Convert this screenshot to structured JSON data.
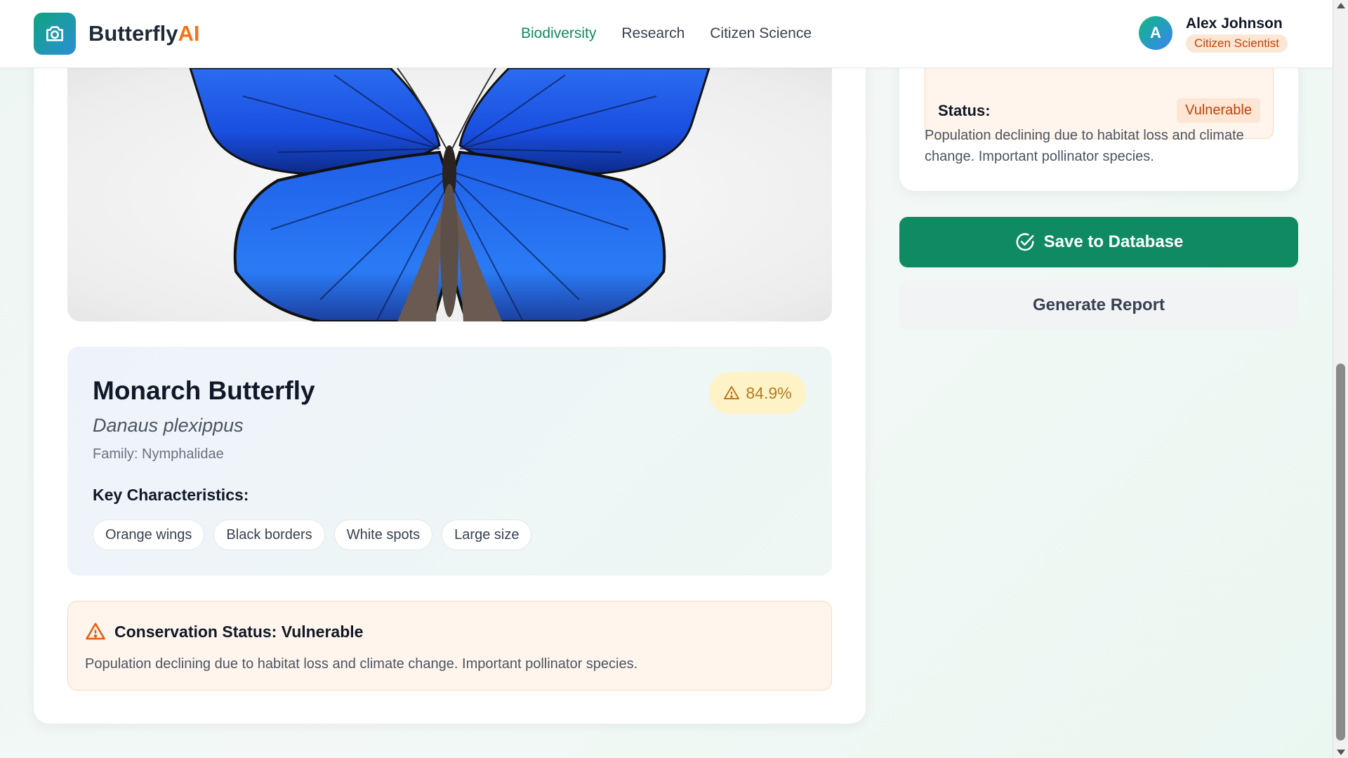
{
  "header": {
    "brand_main": "Butterfly",
    "brand_accent": "AI",
    "brand_icon": "camera-icon",
    "nav": [
      {
        "label": "Biodiversity",
        "active": true
      },
      {
        "label": "Research",
        "active": false
      },
      {
        "label": "Citizen Science",
        "active": false
      }
    ],
    "user": {
      "initial": "A",
      "name": "Alex Johnson",
      "role": "Citizen Scientist"
    }
  },
  "identification": {
    "image_subject": "blue morpho butterfly",
    "common_name": "Monarch Butterfly",
    "scientific_name": "Danaus plexippus",
    "family": "Family: Nymphalidae",
    "confidence": "84.9%",
    "confidence_icon": "warning-icon",
    "characteristics_title": "Key Characteristics:",
    "characteristics": [
      "Orange wings",
      "Black borders",
      "White spots",
      "Large size"
    ]
  },
  "conservation_alert": {
    "icon": "warning-icon",
    "title": "Conservation Status: Vulnerable",
    "text": "Population declining due to habitat loss and climate change. Important pollinator species."
  },
  "status_card": {
    "label": "Status:",
    "value": "Vulnerable",
    "description": "Population declining due to habitat loss and climate change. Important pollinator species."
  },
  "actions": {
    "save_label": "Save to Database",
    "save_icon": "check-circle-icon",
    "report_label": "Generate Report"
  },
  "colors": {
    "primary": "#0f8a63",
    "accent": "#f97316",
    "warning_bg": "#fff5ec",
    "confidence_bg": "#fef3c7"
  }
}
